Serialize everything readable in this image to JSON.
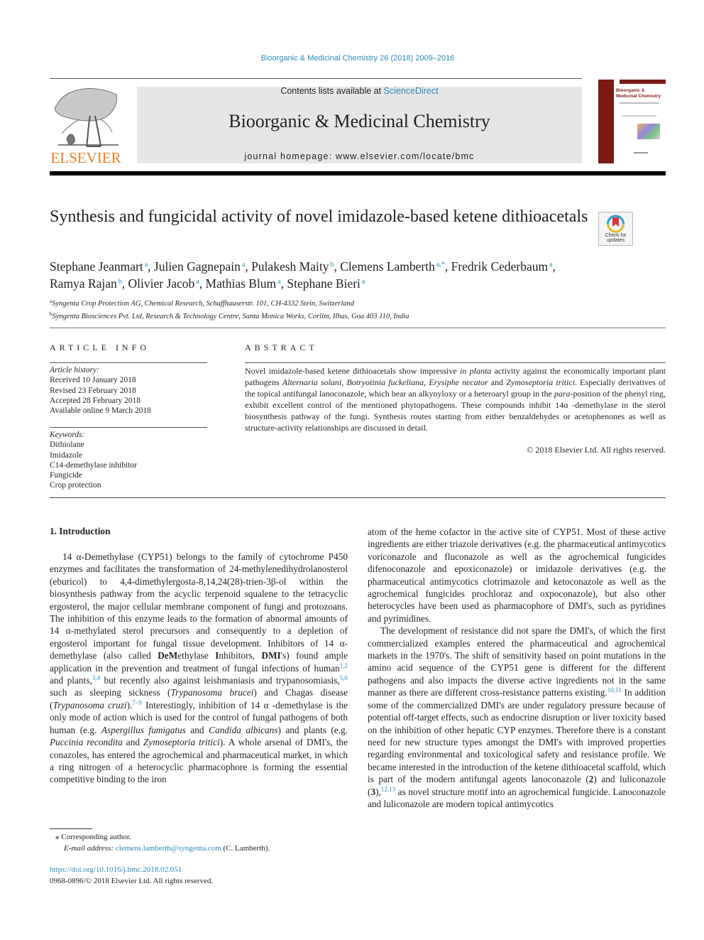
{
  "header": {
    "citation": "Bioorganic & Medicinal Chemistry 26 (2018) 2009–2016",
    "contents_prefix": "Contents lists available at ",
    "contents_link": "ScienceDirect",
    "journal_name": "Bioorganic & Medicinal Chemistry",
    "homepage": "journal homepage: www.elsevier.com/locate/bmc",
    "publisher_wordmark": "ELSEVIER",
    "cover_title": "Bioorganic & Medicinal Chemistry",
    "colors": {
      "link": "#2a8ab8",
      "elsevier_orange": "#f47b20",
      "cover_red": "#7a1a14"
    }
  },
  "article": {
    "title": "Synthesis and fungicidal activity of novel imidazole-based ketene dithioacetals",
    "crossmark_label": "Check for updates",
    "authors": [
      {
        "name": "Stephane Jeanmart",
        "aff": "a"
      },
      {
        "name": "Julien Gagnepain",
        "aff": "a"
      },
      {
        "name": "Pulakesh Maity",
        "aff": "b"
      },
      {
        "name": "Clemens Lamberth",
        "aff": "a,*"
      },
      {
        "name": "Fredrik Cederbaum",
        "aff": "a"
      },
      {
        "name": "Ramya Rajan",
        "aff": "b"
      },
      {
        "name": "Olivier Jacob",
        "aff": "a"
      },
      {
        "name": "Mathias Blum",
        "aff": "a"
      },
      {
        "name": "Stephane Bieri",
        "aff": "a"
      }
    ],
    "affiliations": [
      {
        "key": "a",
        "text": "Syngenta Crop Protection AG, Chemical Research, Schaffhauserstr. 101, CH-4332 Stein, Switzerland"
      },
      {
        "key": "b",
        "text": "Syngenta Biosciences Pvt. Ltd, Research & Technology Centre, Santa Monica Works, Corlim, Ilhas, Goa 403 110, India"
      }
    ]
  },
  "article_info": {
    "heading": "ARTICLE INFO",
    "history_label": "Article history:",
    "history": [
      "Received 10 January 2018",
      "Revised 23 February 2018",
      "Accepted 28 February 2018",
      "Available online 9 March 2018"
    ],
    "keywords_label": "Keywords:",
    "keywords": [
      "Dithiolane",
      "Imidazole",
      "C14-demethylase inhibitor",
      "Fungicide",
      "Crop protection"
    ]
  },
  "abstract": {
    "heading": "ABSTRACT",
    "segments": [
      {
        "t": "Novel imidazole-based ketene dithioacetals show impressive "
      },
      {
        "t": "in planta",
        "i": true
      },
      {
        "t": " activity against the economically important plant pathogens "
      },
      {
        "t": "Alternaria solani",
        "i": true
      },
      {
        "t": ", "
      },
      {
        "t": "Botryotinia fuckeliana",
        "i": true
      },
      {
        "t": ", "
      },
      {
        "t": "Erysiphe necator",
        "i": true
      },
      {
        "t": " and "
      },
      {
        "t": "Zymoseptoria tritici",
        "i": true
      },
      {
        "t": ". Especially derivatives of the topical antifungal lanoconazole, which bear an alkynyloxy or a heteroaryl group in the "
      },
      {
        "t": "para",
        "i": true
      },
      {
        "t": "-position of the phenyl ring, exhibit excellent control of the mentioned phytopathogens. These compounds inhibit 14α -demethylase in the sterol biosynthesis pathway of the fungi. Synthesis routes starting from either benzaldehydes or acetophenones as well as structure-activity relationships are discussed in detail."
      }
    ],
    "copyright": "© 2018 Elsevier Ltd. All rights reserved."
  },
  "introduction": {
    "heading": "1. Introduction",
    "left_paragraphs": [
      [
        {
          "t": "14 α-Demethylase (CYP51) belongs to the family of cytochrome P450 enzymes and facilitates the transformation of 24-methylenedihydrolanosterol (eburicol) to 4,4-dimethylergosta-8,14,24(28)-trien-3β-ol within the biosynthesis pathway from the acyclic terpenoid squalene to the tetracyclic ergosterol, the major cellular membrane component of fungi and protozoans. The inhibition of this enzyme leads to the formation of abnormal amounts of 14 α-methylated sterol precursors and consequently to a depletion of ergosterol important for fungal tissue development. Inhibitors of 14 α-demethylase (also called "
        },
        {
          "t": "De",
          "b": true
        },
        {
          "t": "M",
          "b": true
        },
        {
          "t": "ethylase "
        },
        {
          "t": "I",
          "b": true
        },
        {
          "t": "nhibitors, "
        },
        {
          "t": "DMI",
          "b": true
        },
        {
          "t": "'s) found ample application in the prevention and treatment of fungal infections of human"
        },
        {
          "t": "1,2",
          "sup": true
        },
        {
          "t": " and plants,"
        },
        {
          "t": "3,4",
          "sup": true
        },
        {
          "t": " but recently also against leishmaniasis and trypanosomiasis,"
        },
        {
          "t": "5,6",
          "sup": true
        },
        {
          "t": " such as sleeping sickness ("
        },
        {
          "t": "Trypanosoma brucei",
          "i": true
        },
        {
          "t": ") and Chagas disease ("
        },
        {
          "t": "Trypanosoma cruzi",
          "i": true
        },
        {
          "t": ")."
        },
        {
          "t": "7–9",
          "sup": true
        },
        {
          "t": " Interestingly, inhibition of 14 α -demethylase is the only mode of action which is used for the control of fungal pathogens of both human (e.g. "
        },
        {
          "t": "Aspergillus fumigatus",
          "i": true
        },
        {
          "t": " and "
        },
        {
          "t": "Candida albicans",
          "i": true
        },
        {
          "t": ") and plants (e.g. "
        },
        {
          "t": "Puccinia recondita",
          "i": true
        },
        {
          "t": " and "
        },
        {
          "t": "Zymoseptoria tritici",
          "i": true
        },
        {
          "t": "). A whole arsenal of DMI's, the conazoles, has entered the agrochemical and pharmaceutical market, in which a ring nitrogen of a heterocyclic pharmacophore is forming the essential competitive binding to the iron"
        }
      ]
    ],
    "right_paragraphs": [
      [
        {
          "t": "atom of the heme cofactor in the active site of CYP51. Most of these active ingredients are either triazole derivatives (e.g. the pharmaceutical antimycotics voriconazole and fluconazole as well as the agrochemical fungicides difenoconazole and epoxiconazole) or imidazole derivatives (e.g. the pharmaceutical antimycotics clotrimazole and ketoconazole as well as the agrochemical fungicides prochloraz and oxpoconazole), but also other heterocycles have been used as pharmacophore of DMI's, such as pyridines and pyrimidines."
        }
      ],
      [
        {
          "t": "The development of resistance did not spare the DMI's, of which the first commercialized examples entered the pharmaceutical and agrochemical markets in the 1970's. The shift of sensitivity based on point mutations in the amino acid sequence of the CYP51 gene is different for the different pathogens and also impacts the diverse active ingredients not in the same manner as there are different cross-resistance patterns existing."
        },
        {
          "t": "10,11",
          "sup": true
        },
        {
          "t": " In addition some of the commercialized DMI's are under regulatory pressure because of potential off-target effects, such as endocrine disruption or liver toxicity based on the inhibition of other hepatic CYP enzymes. Therefore there is a constant need for new structure types amongst the DMI's with improved properties regarding environmental and toxicological safety and resistance profile. We became interested in the introduction of the ketene dithioacetal scaffold, which is part of the modern antifungal agents lanoconazole ("
        },
        {
          "t": "2",
          "b": true
        },
        {
          "t": ") and luliconazole ("
        },
        {
          "t": "3",
          "b": true
        },
        {
          "t": "),"
        },
        {
          "t": "12,13",
          "sup": true
        },
        {
          "t": " as novel structure motif into an agrochemical fungicide. Lanoconazole and luliconazole are modern topical antimycotics"
        }
      ]
    ]
  },
  "footnotes": {
    "corresponding_marker": "⁎",
    "corresponding_text": "Corresponding author.",
    "email_label": "E-mail address: ",
    "email": "clemens.lamberth@syngenta.com",
    "email_suffix": " (C. Lamberth).",
    "doi": "https://doi.org/10.1016/j.bmc.2018.02.051",
    "issn_line": "0968-0896/© 2018 Elsevier Ltd. All rights reserved."
  }
}
